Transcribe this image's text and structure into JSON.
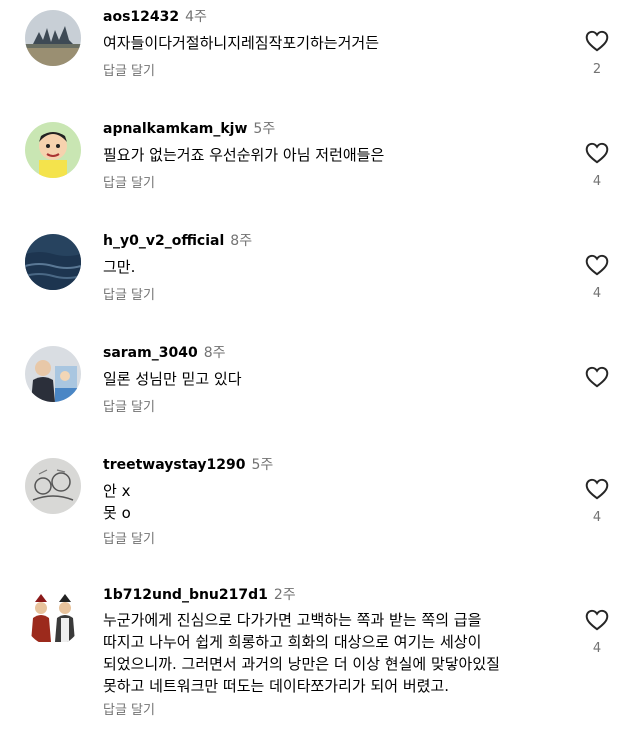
{
  "comments": [
    {
      "username": "aos12432",
      "age": "4주",
      "text": "여자들이다거절하니지레짐작포기하는거거든",
      "reply": "답글 달기",
      "likes": "2",
      "avatar_icon": "landscape-avatar-icon"
    },
    {
      "username": "apnalkamkam_kjw",
      "age": "5주",
      "text": "필요가 없는거죠 우선순위가 아님 저런애들은",
      "reply": "답글 달기",
      "likes": "4",
      "avatar_icon": "cartoon-boy-avatar-icon"
    },
    {
      "username": "h_y0_v2_official",
      "age": "8주",
      "text": "그만.",
      "reply": "답글 달기",
      "likes": "4",
      "avatar_icon": "ocean-avatar-icon"
    },
    {
      "username": "saram_3040",
      "age": "8주",
      "text": "일론 성님만 믿고 있다",
      "reply": "답글 달기",
      "likes": "",
      "avatar_icon": "photo-avatar-icon"
    },
    {
      "username": "treetwaystay1290",
      "age": "5주",
      "text": "안 x\n못 o",
      "reply": "답글 달기",
      "likes": "4",
      "avatar_icon": "sketch-avatar-icon"
    },
    {
      "username": "1b712und_bnu217d1",
      "age": "2주",
      "text": "누군가에게 진심으로 다가가면 고백하는 쪽과 받는 쪽의 급을\n따지고 나누어 쉽게 희롱하고 희화의 대상으로 여기는 세상이\n되었으니까. 그러면서 과거의 낭만은 더 이상 현실에 맞닿아있질\n못하고 네트워크만 떠도는 데이타쪼가리가 되어 버렸고.",
      "reply": "답글 달기",
      "likes": "4",
      "avatar_icon": "warriors-avatar-icon"
    }
  ]
}
